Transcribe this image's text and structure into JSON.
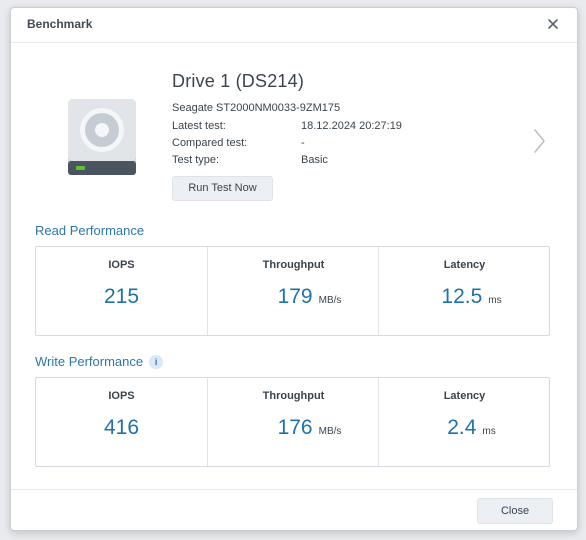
{
  "window": {
    "title": "Benchmark"
  },
  "drive": {
    "name": "Drive 1 (DS214)",
    "model": "Seagate ST2000NM0033-9ZM175",
    "details": [
      {
        "label": "Latest test:",
        "value": "18.12.2024 20:27:19"
      },
      {
        "label": "Compared test:",
        "value": "-"
      },
      {
        "label": "Test type:",
        "value": "Basic"
      }
    ],
    "run_button": "Run Test Now"
  },
  "read": {
    "title": "Read Performance",
    "metrics": [
      {
        "label": "IOPS",
        "value": "215",
        "unit": ""
      },
      {
        "label": "Throughput",
        "value": "179",
        "unit": "MB/s"
      },
      {
        "label": "Latency",
        "value": "12.5",
        "unit": "ms"
      }
    ]
  },
  "write": {
    "title": "Write Performance",
    "info_icon": "i",
    "metrics": [
      {
        "label": "IOPS",
        "value": "416",
        "unit": ""
      },
      {
        "label": "Throughput",
        "value": "176",
        "unit": "MB/s"
      },
      {
        "label": "Latency",
        "value": "2.4",
        "unit": "ms"
      }
    ]
  },
  "footer": {
    "close_label": "Close"
  },
  "colors": {
    "accent": "#2171ab",
    "section_title": "#2e76ad",
    "drive_led": "#5fc236"
  },
  "icons": {
    "close": "close-icon",
    "drive": "hard-drive-icon",
    "next": "chevron-right-icon",
    "info": "info-icon"
  }
}
